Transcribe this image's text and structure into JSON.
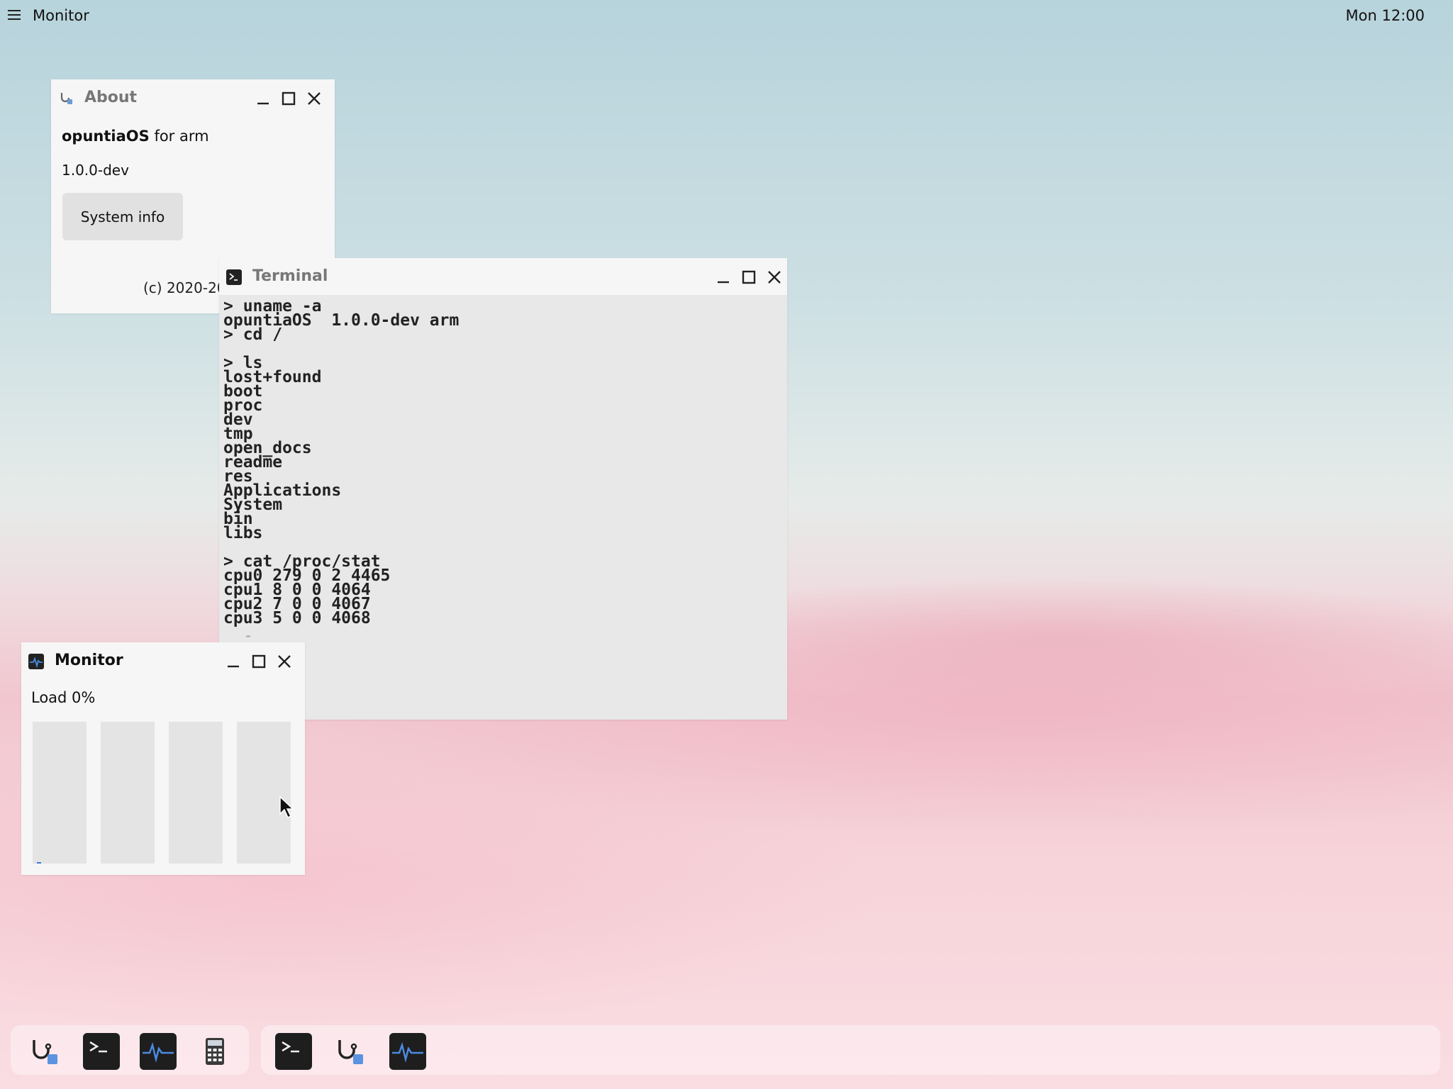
{
  "topbar": {
    "app_name": "Monitor",
    "clock": "Mon 12:00",
    "menu_icon": "hamburger-icon"
  },
  "about_window": {
    "title": "About",
    "os_name": "opuntiaOS",
    "os_suffix": "for arm",
    "version": "1.0.0-dev",
    "system_info_button": "System info",
    "copyright": "(c) 2020-20"
  },
  "terminal_window": {
    "title": "Terminal",
    "output": "> uname -a\nopuntiaOS  1.0.0-dev arm\n> cd /\n\n> ls\nlost+found\nboot\nproc\ndev\ntmp\nopen_docs\nreadme\nres\nApplications\nSystem\nbin\nlibs\n\n> cat /proc/stat\ncpu0 279 0 2 4465\ncpu1 8 0 0 4064\ncpu2 7 0 0 4067\ncpu3 5 0 0 4068"
  },
  "monitor_window": {
    "title": "Monitor",
    "load_label": "Load 0%",
    "cpu_loads": [
      0.01,
      0,
      0,
      0
    ],
    "accent_color": "#3b7bd6"
  },
  "dock": {
    "left_items": [
      "about-app",
      "terminal-app",
      "monitor-app",
      "calculator-app"
    ],
    "right_items": [
      "terminal-running",
      "about-running",
      "monitor-running"
    ]
  }
}
